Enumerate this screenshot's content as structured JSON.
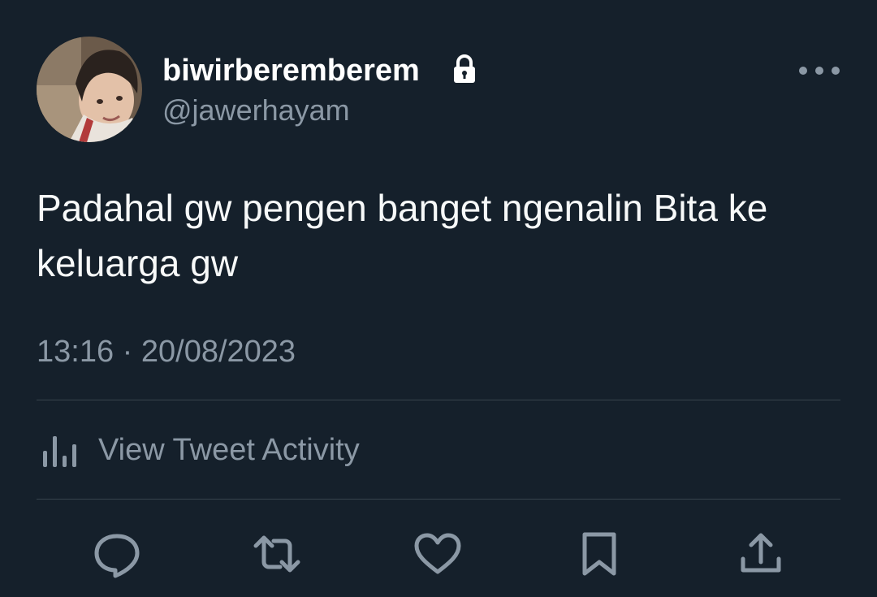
{
  "tweet": {
    "author": {
      "display_name": "biwirberemberem",
      "handle": "@jawerhayam",
      "protected_icon": "lock-icon"
    },
    "text": "Padahal gw pengen banget ngenalin Bita ke keluarga gw",
    "timestamp": "13:16 · 20/08/2023",
    "activity_label": "View Tweet Activity",
    "menu_icon": "more-options-icon"
  },
  "actions": [
    {
      "name": "reply",
      "icon": "reply-icon"
    },
    {
      "name": "retweet",
      "icon": "retweet-icon"
    },
    {
      "name": "like",
      "icon": "heart-icon"
    },
    {
      "name": "bookmark",
      "icon": "bookmark-icon"
    },
    {
      "name": "share",
      "icon": "share-icon"
    }
  ],
  "colors": {
    "background": "#15202b",
    "primary_text": "#f7f9f9",
    "secondary_text": "#8b98a5",
    "divider": "#38444d",
    "icon": "#8b98a5"
  }
}
